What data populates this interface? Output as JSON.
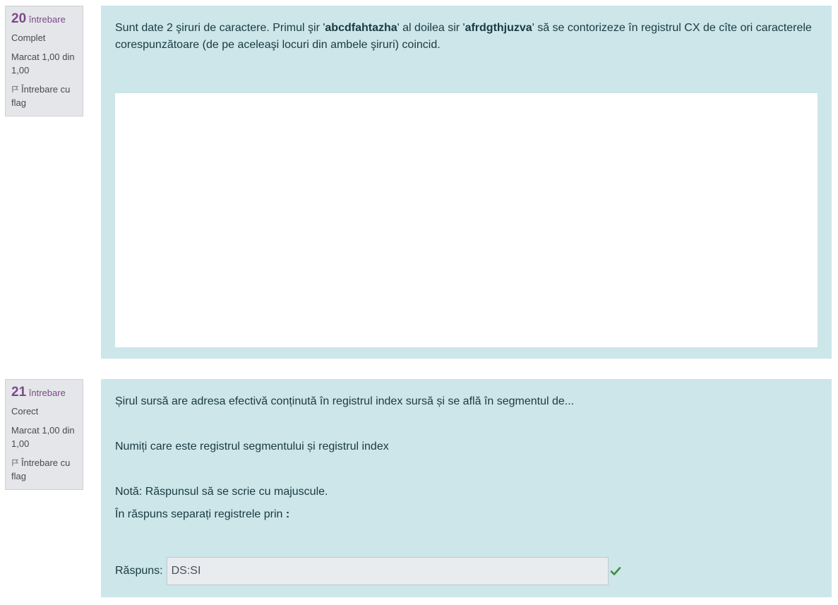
{
  "q20": {
    "number": "20",
    "word": "întrebare",
    "state": "Complet",
    "grade": "Marcat 1,00 din 1,00",
    "flag_label": "Întrebare cu flag",
    "text_part1": "Sunt date 2 şiruri de caractere. Primul şir '",
    "bold1": "abcdfahtazha",
    "text_part2": "' al doilea sir '",
    "bold2": "afrdgthjuzva",
    "text_part3": "' să se contorizeze în registrul CX de cîte ori caracterele corespunzătoare (de pe aceleaşi locuri din ambele şiruri) coincid."
  },
  "q21": {
    "number": "21",
    "word": "întrebare",
    "state": "Corect",
    "grade": "Marcat 1,00 din 1,00",
    "flag_label": "Întrebare cu flag",
    "line1": "Șirul sursă are adresa efectivă conținută în registrul index sursă și se află în segmentul de...",
    "line2": "Numiți care este registrul segmentului și registrul index",
    "line3": "Notă: Răspunsul să se scrie cu majuscule.",
    "line4_text": "În răspuns separați registrele  prin ",
    "line4_bold": ":",
    "answer_label": "Răspuns:",
    "answer_value": "DS:SI"
  },
  "colors": {
    "content_bg": "#cce6ea",
    "info_bg": "#e5e6ea",
    "accent": "#7b4a88",
    "correct": "#3c8d40"
  }
}
